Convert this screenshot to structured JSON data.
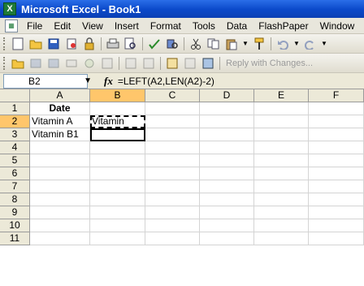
{
  "window": {
    "title": "Microsoft Excel - Book1",
    "app_icon": "X"
  },
  "menu": [
    "File",
    "Edit",
    "View",
    "Insert",
    "Format",
    "Tools",
    "Data",
    "FlashPaper",
    "Window"
  ],
  "toolbar2": {
    "reply_text": "Reply with Changes..."
  },
  "formula_bar": {
    "name_box": "B2",
    "fx": "fx",
    "formula": "=LEFT(A2,LEN(A2)-2)"
  },
  "columns": [
    "A",
    "B",
    "C",
    "D",
    "E",
    "F"
  ],
  "rows": [
    "1",
    "2",
    "3",
    "4",
    "5",
    "6",
    "7",
    "8",
    "9",
    "10",
    "11"
  ],
  "cells": {
    "A1": "Date",
    "A2": "Vitamin A",
    "B2": "Vitamin",
    "A3": "Vitamin B1"
  },
  "colors": {
    "title_blue": "#0a48c9",
    "selected_header": "#ffc66b"
  }
}
